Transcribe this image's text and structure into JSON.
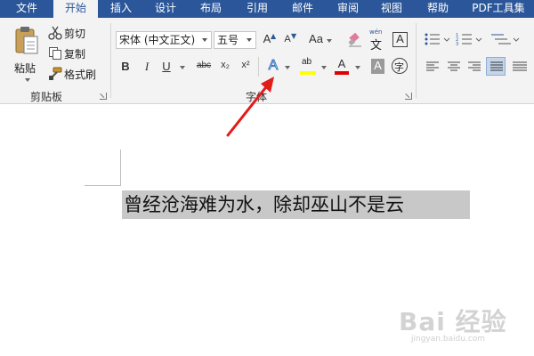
{
  "tabs": [
    "文件",
    "开始",
    "插入",
    "设计",
    "布局",
    "引用",
    "邮件",
    "审阅",
    "视图",
    "帮助",
    "PDF工具集"
  ],
  "clipboard": {
    "paste_label": "粘贴",
    "cut_label": "剪切",
    "copy_label": "复制",
    "format_painter_label": "格式刷",
    "group_label": "剪贴板"
  },
  "font": {
    "font_name": "宋体 (中文正文)",
    "font_size": "五号",
    "group_label": "字体",
    "grow_label": "A",
    "shrink_label": "A",
    "change_case_label": "Aa",
    "pinyin_label": "wén",
    "pinyin_char": "文",
    "border_char_label": "A",
    "bold_label": "B",
    "italic_label": "I",
    "underline_label": "U",
    "strike_label": "abc",
    "subscript_label": "x₂",
    "superscript_label": "x²",
    "text_effect_label": "A",
    "highlight_label": "ab",
    "font_color_label": "A",
    "shading_label": "A",
    "enclose_label": "字"
  },
  "colors": {
    "tabbar": "#2b579a",
    "highlight": "#ffff00",
    "font_color": "#e00000",
    "arrow": "#e21b1b"
  },
  "document": {
    "selected_text": "曾经沧海难为水，除却巫山不是云"
  },
  "watermark": {
    "main": "Bai 经验",
    "sub": "jingyan.baidu.com"
  }
}
